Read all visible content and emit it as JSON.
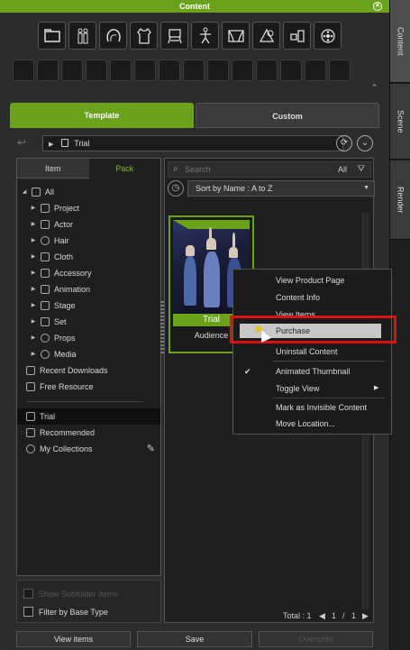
{
  "window": {
    "title": "Content"
  },
  "side_tabs": [
    "Content",
    "Scene",
    "Render"
  ],
  "toolbar": {
    "icons": [
      "project-icon",
      "actor-icon",
      "hair-icon",
      "cloth-icon",
      "accessory-icon",
      "animation-icon",
      "stage-icon",
      "set-icon",
      "props-icon",
      "media-icon"
    ]
  },
  "tabs": {
    "template": "Template",
    "custom": "Custom"
  },
  "path": {
    "current": "Trial"
  },
  "left": {
    "tab_item": "Item",
    "tab_pack": "Pack",
    "tree": [
      "All",
      "Project",
      "Actor",
      "Hair",
      "Cloth",
      "Accessory",
      "Animation",
      "Stage",
      "Set",
      "Props",
      "Media",
      "Recent Downloads",
      "Free Resource"
    ],
    "lower": [
      "Trial",
      "Recommended",
      "My Collections"
    ],
    "opt_subfolder": "Show Subfolder Items",
    "opt_filter": "Filter by Base Type"
  },
  "right": {
    "search_placeholder": "Search",
    "search_scope": "All",
    "sort_label": "Sort by Name : A to Z",
    "card": {
      "badge": "Trial",
      "name": "Audience"
    },
    "total": "Total : 1",
    "page": "1",
    "page_sep": "/",
    "pages": "1"
  },
  "menu": {
    "items": [
      "View Product Page",
      "Content Info",
      "View Items",
      "Purchase",
      "Uninstall Content",
      "Animated Thumbnail",
      "Toggle View",
      "Mark as Invisible Content",
      "Move Location..."
    ],
    "highlighted": "Purchase"
  },
  "bottom": {
    "view_items": "View items",
    "save": "Save",
    "overwrite": "Overwrite"
  },
  "colors": {
    "accent": "#6aa21c",
    "highlight": "#d11111"
  }
}
